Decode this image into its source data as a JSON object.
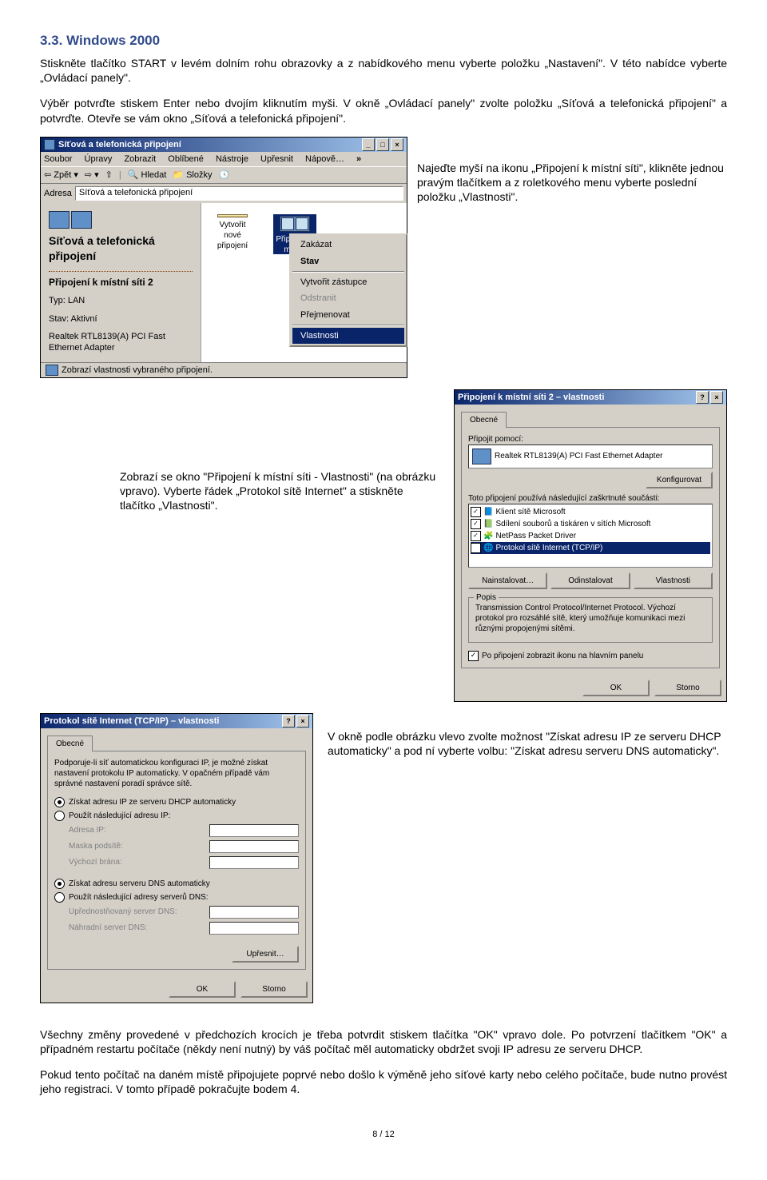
{
  "heading": "3.3. Windows 2000",
  "p1": "Stiskněte tlačítko START v levém dolním rohu obrazovky a z nabídkového menu vyberte položku „Nastavení\". V této nabídce vyberte „Ovládací panely\".",
  "p2": "Výběr potvrďte stiskem Enter nebo dvojím kliknutím myši. V okně „Ovládací panely\" zvolte položku „Síťová a telefonická připojení\" a potvrďte. Otevře se vám okno „Síťová a telefonická připojení\".",
  "explorer": {
    "title": "Síťová a telefonická připojení",
    "menu": [
      "Soubor",
      "Úpravy",
      "Zobrazit",
      "Oblíbené",
      "Nástroje",
      "Upřesnit",
      "Nápově…"
    ],
    "back": "Zpět",
    "search": "Hledat",
    "folders": "Složky",
    "adresa": "Adresa",
    "adresa_value": "Síťová a telefonická připojení",
    "side_heading": "Síťová a telefonická připojení",
    "side_bold": "Připojení k místní síti 2",
    "side_type": "Typ: LAN",
    "side_state": "Stav: Aktivní",
    "side_device": "Realtek RTL8139(A) PCI Fast Ethernet Adapter",
    "icon1": "Vytvořit nové připojení",
    "icon2": "Připojení k místní síti…",
    "ctx": {
      "disable": "Zakázat",
      "stav": "Stav",
      "shortcut": "Vytvořit zástupce",
      "delete": "Odstranit",
      "rename": "Přejmenovat",
      "props": "Vlastnosti"
    },
    "statusbar": "Zobrazí vlastnosti vybraného připojení."
  },
  "cap1": "Najeďte myší na ikonu „Připojení k místní síti\", klikněte jednou pravým tlačítkem a z roletkového menu vyberte poslední položku „Vlastnosti\".",
  "props": {
    "title": "Připojení k místní síti 2 – vlastnosti",
    "tab": "Obecné",
    "lbl1": "Připojit pomocí:",
    "device": "Realtek RTL8139(A) PCI Fast Ethernet Adapter",
    "configure": "Konfigurovat",
    "lbl2": "Toto připojení používá následující zaškrtnuté součásti:",
    "items": [
      "Klient sítě Microsoft",
      "Sdílení souborů a tiskáren v sítích Microsoft",
      "NetPass Packet Driver",
      "Protokol sítě Internet (TCP/IP)"
    ],
    "install": "Nainstalovat…",
    "uninstall": "Odinstalovat",
    "btnprops": "Vlastnosti",
    "group": "Popis",
    "desc": "Transmission Control Protocol/Internet Protocol. Výchozí protokol pro rozsáhlé sítě, který umožňuje komunikaci mezi různými propojenými sítěmi.",
    "checkbox": "Po připojení zobrazit ikonu na hlavním panelu",
    "ok": "OK",
    "cancel": "Storno"
  },
  "cap2": "Zobrazí se okno \"Připojení k místní síti - Vlastnosti\" (na obrázku vpravo). Vyberte řádek „Protokol sítě Internet\" a stiskněte tlačítko „Vlastnosti\".",
  "tcpip": {
    "title": "Protokol sítě Internet (TCP/IP) – vlastnosti",
    "tab": "Obecné",
    "intro": "Podporuje-li síť automatickou konfiguraci IP, je možné získat nastavení protokolu IP automaticky. V opačném případě vám správné nastavení poradí správce sítě.",
    "r1": "Získat adresu IP ze serveru DHCP automaticky",
    "r2": "Použít následující adresu IP:",
    "f1": "Adresa IP:",
    "f2": "Maska podsítě:",
    "f3": "Výchozí brána:",
    "r3": "Získat adresu serveru DNS automaticky",
    "r4": "Použít následující adresy serverů DNS:",
    "f4": "Upřednostňovaný server DNS:",
    "f5": "Náhradní server DNS:",
    "adv": "Upřesnit…",
    "ok": "OK",
    "cancel": "Storno"
  },
  "cap3": "V okně podle obrázku vlevo zvolte možnost \"Získat adresu IP ze serveru DHCP automaticky\" a pod ní vyberte volbu: \"Získat adresu serveru DNS automaticky\".",
  "p_end1": "Všechny změny provedené v předchozích krocích je třeba potvrdit stiskem tlačítka \"OK\" vpravo dole. Po potvrzení tlačítkem \"OK\" a případném restartu počítače (někdy není nutný) by váš počítač měl automaticky obdržet svoji IP adresu ze serveru DHCP.",
  "p_end2": "Pokud tento počítač na daném místě připojujete poprvé nebo došlo k výměně jeho síťové karty nebo celého počítače, bude nutno provést jeho registraci. V tomto případě pokračujte bodem 4.",
  "pagenum": "8 / 12"
}
